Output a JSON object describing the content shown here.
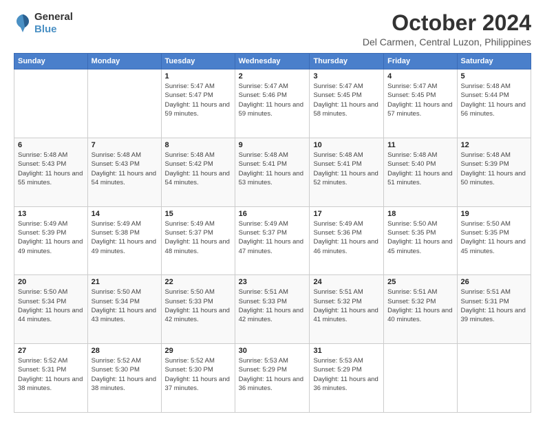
{
  "logo": {
    "line1": "General",
    "line2": "Blue"
  },
  "title": "October 2024",
  "location": "Del Carmen, Central Luzon, Philippines",
  "weekdays": [
    "Sunday",
    "Monday",
    "Tuesday",
    "Wednesday",
    "Thursday",
    "Friday",
    "Saturday"
  ],
  "weeks": [
    [
      {
        "day": "",
        "info": ""
      },
      {
        "day": "",
        "info": ""
      },
      {
        "day": "1",
        "info": "Sunrise: 5:47 AM\nSunset: 5:47 PM\nDaylight: 11 hours and 59 minutes."
      },
      {
        "day": "2",
        "info": "Sunrise: 5:47 AM\nSunset: 5:46 PM\nDaylight: 11 hours and 59 minutes."
      },
      {
        "day": "3",
        "info": "Sunrise: 5:47 AM\nSunset: 5:45 PM\nDaylight: 11 hours and 58 minutes."
      },
      {
        "day": "4",
        "info": "Sunrise: 5:47 AM\nSunset: 5:45 PM\nDaylight: 11 hours and 57 minutes."
      },
      {
        "day": "5",
        "info": "Sunrise: 5:48 AM\nSunset: 5:44 PM\nDaylight: 11 hours and 56 minutes."
      }
    ],
    [
      {
        "day": "6",
        "info": "Sunrise: 5:48 AM\nSunset: 5:43 PM\nDaylight: 11 hours and 55 minutes."
      },
      {
        "day": "7",
        "info": "Sunrise: 5:48 AM\nSunset: 5:43 PM\nDaylight: 11 hours and 54 minutes."
      },
      {
        "day": "8",
        "info": "Sunrise: 5:48 AM\nSunset: 5:42 PM\nDaylight: 11 hours and 54 minutes."
      },
      {
        "day": "9",
        "info": "Sunrise: 5:48 AM\nSunset: 5:41 PM\nDaylight: 11 hours and 53 minutes."
      },
      {
        "day": "10",
        "info": "Sunrise: 5:48 AM\nSunset: 5:41 PM\nDaylight: 11 hours and 52 minutes."
      },
      {
        "day": "11",
        "info": "Sunrise: 5:48 AM\nSunset: 5:40 PM\nDaylight: 11 hours and 51 minutes."
      },
      {
        "day": "12",
        "info": "Sunrise: 5:48 AM\nSunset: 5:39 PM\nDaylight: 11 hours and 50 minutes."
      }
    ],
    [
      {
        "day": "13",
        "info": "Sunrise: 5:49 AM\nSunset: 5:39 PM\nDaylight: 11 hours and 49 minutes."
      },
      {
        "day": "14",
        "info": "Sunrise: 5:49 AM\nSunset: 5:38 PM\nDaylight: 11 hours and 49 minutes."
      },
      {
        "day": "15",
        "info": "Sunrise: 5:49 AM\nSunset: 5:37 PM\nDaylight: 11 hours and 48 minutes."
      },
      {
        "day": "16",
        "info": "Sunrise: 5:49 AM\nSunset: 5:37 PM\nDaylight: 11 hours and 47 minutes."
      },
      {
        "day": "17",
        "info": "Sunrise: 5:49 AM\nSunset: 5:36 PM\nDaylight: 11 hours and 46 minutes."
      },
      {
        "day": "18",
        "info": "Sunrise: 5:50 AM\nSunset: 5:35 PM\nDaylight: 11 hours and 45 minutes."
      },
      {
        "day": "19",
        "info": "Sunrise: 5:50 AM\nSunset: 5:35 PM\nDaylight: 11 hours and 45 minutes."
      }
    ],
    [
      {
        "day": "20",
        "info": "Sunrise: 5:50 AM\nSunset: 5:34 PM\nDaylight: 11 hours and 44 minutes."
      },
      {
        "day": "21",
        "info": "Sunrise: 5:50 AM\nSunset: 5:34 PM\nDaylight: 11 hours and 43 minutes."
      },
      {
        "day": "22",
        "info": "Sunrise: 5:50 AM\nSunset: 5:33 PM\nDaylight: 11 hours and 42 minutes."
      },
      {
        "day": "23",
        "info": "Sunrise: 5:51 AM\nSunset: 5:33 PM\nDaylight: 11 hours and 42 minutes."
      },
      {
        "day": "24",
        "info": "Sunrise: 5:51 AM\nSunset: 5:32 PM\nDaylight: 11 hours and 41 minutes."
      },
      {
        "day": "25",
        "info": "Sunrise: 5:51 AM\nSunset: 5:32 PM\nDaylight: 11 hours and 40 minutes."
      },
      {
        "day": "26",
        "info": "Sunrise: 5:51 AM\nSunset: 5:31 PM\nDaylight: 11 hours and 39 minutes."
      }
    ],
    [
      {
        "day": "27",
        "info": "Sunrise: 5:52 AM\nSunset: 5:31 PM\nDaylight: 11 hours and 38 minutes."
      },
      {
        "day": "28",
        "info": "Sunrise: 5:52 AM\nSunset: 5:30 PM\nDaylight: 11 hours and 38 minutes."
      },
      {
        "day": "29",
        "info": "Sunrise: 5:52 AM\nSunset: 5:30 PM\nDaylight: 11 hours and 37 minutes."
      },
      {
        "day": "30",
        "info": "Sunrise: 5:53 AM\nSunset: 5:29 PM\nDaylight: 11 hours and 36 minutes."
      },
      {
        "day": "31",
        "info": "Sunrise: 5:53 AM\nSunset: 5:29 PM\nDaylight: 11 hours and 36 minutes."
      },
      {
        "day": "",
        "info": ""
      },
      {
        "day": "",
        "info": ""
      }
    ]
  ]
}
